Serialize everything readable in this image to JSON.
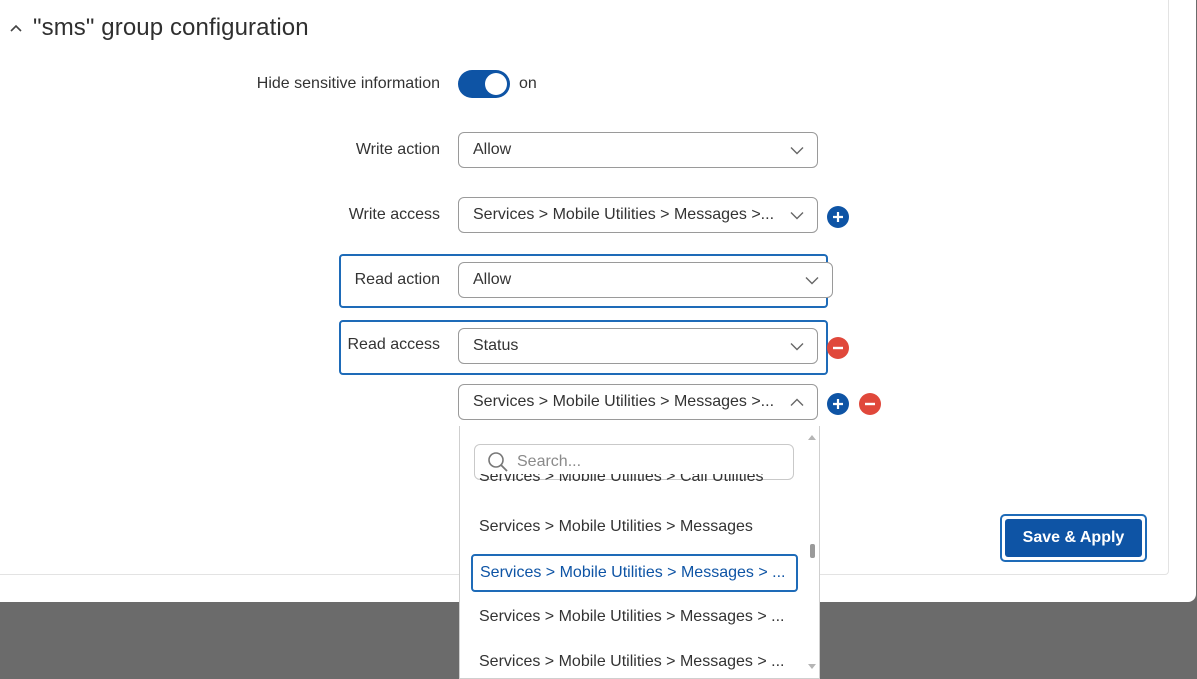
{
  "section": {
    "title": "\"sms\" group configuration"
  },
  "hide_sensitive": {
    "label": "Hide sensitive information",
    "state": "on"
  },
  "write_action": {
    "label": "Write action",
    "value": "Allow"
  },
  "write_access": {
    "label": "Write access",
    "value": "Services > Mobile Utilities > Messages >..."
  },
  "read_action": {
    "label": "Read action",
    "value": "Allow"
  },
  "read_access": {
    "label": "Read access",
    "value": "Status"
  },
  "read_access_extra": {
    "value": "Services > Mobile Utilities > Messages >..."
  },
  "dropdown": {
    "search_placeholder": "Search...",
    "options": [
      "Services > Mobile Utilities > Call Utilities",
      "Services > Mobile Utilities > Messages",
      "Services > Mobile Utilities > Messages > ...",
      "Services > Mobile Utilities > Messages > ...",
      "Services > Mobile Utilities > Messages > ..."
    ]
  },
  "save_button": {
    "label": "Save & Apply"
  },
  "colors": {
    "primary": "#0e54a5",
    "danger": "#e0483b",
    "focus": "#1e6bb8",
    "backdrop": "#6b6b6b"
  }
}
